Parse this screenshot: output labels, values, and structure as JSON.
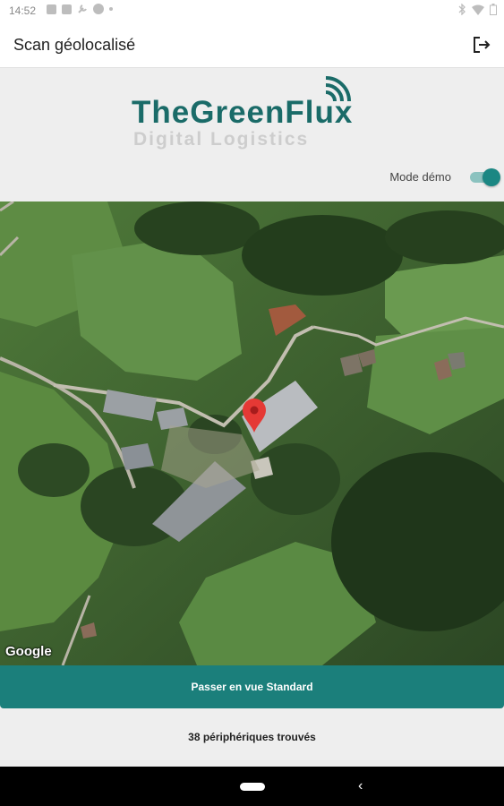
{
  "status_bar": {
    "time": "14:52",
    "left_icons": [
      "gallery-icon",
      "document-icon",
      "wrench-icon",
      "circle-icon",
      "dot-icon"
    ],
    "right_icons": [
      "bluetooth-icon",
      "wifi-icon",
      "battery-icon"
    ]
  },
  "app_bar": {
    "title": "Scan géolocalisé",
    "logout_icon": "logout-icon"
  },
  "logo": {
    "main": "TheGreenFlux",
    "sub": "Digital Logistics",
    "signal_icon": "signal-waves-icon"
  },
  "demo_mode": {
    "label": "Mode démo",
    "enabled": true
  },
  "map": {
    "provider": "Google",
    "marker_icon": "map-pin-icon"
  },
  "actions": {
    "view_button_label": "Passer en vue Standard"
  },
  "footer": {
    "devices_text": "38 périphériques trouvés"
  },
  "colors": {
    "brand": "#1a6b68",
    "button": "#1b7f7b",
    "toggle": "#1b8783"
  }
}
